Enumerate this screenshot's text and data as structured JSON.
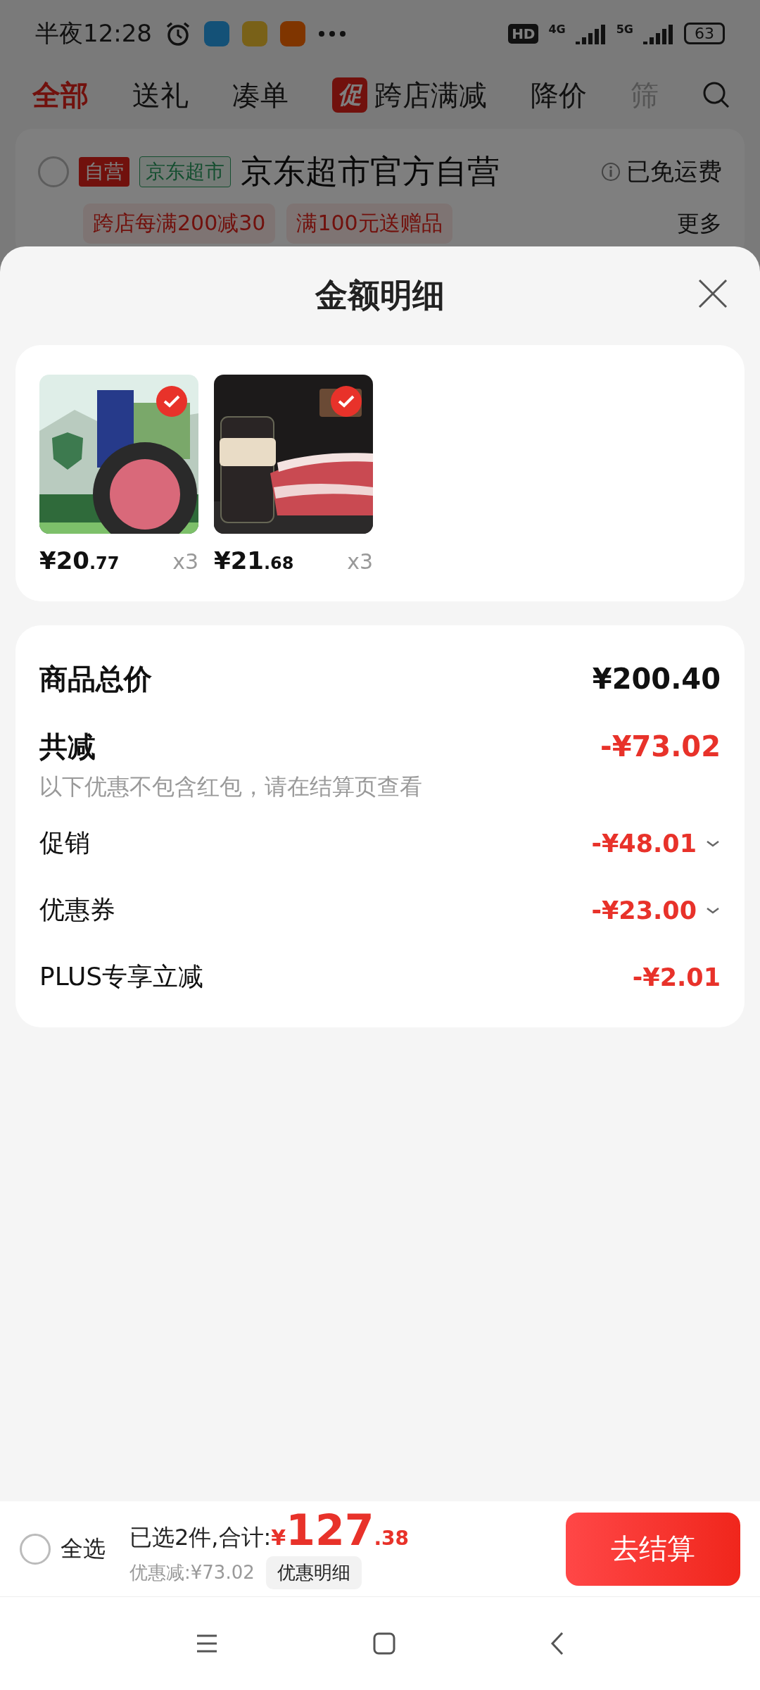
{
  "status_bar": {
    "time": "半夜12:28",
    "battery": "63",
    "network_labels": [
      "HD",
      "4G",
      "5G"
    ]
  },
  "tabs": [
    {
      "label": "全部",
      "selected": true
    },
    {
      "label": "送礼",
      "selected": false
    },
    {
      "label": "凑单",
      "selected": false
    },
    {
      "label": "跨店满减",
      "badge": "促",
      "selected": false
    },
    {
      "label": "降价",
      "selected": false
    },
    {
      "label": "筛",
      "selected": false
    }
  ],
  "store": {
    "checked": false,
    "tags": [
      {
        "label": "自营",
        "kind": "solid"
      },
      {
        "label": "京东超市",
        "kind": "outline"
      }
    ],
    "name": "京东超市官方自营",
    "shipping": "已免运费",
    "promos": [
      "跨店每满200减30",
      "满100元送赠品"
    ],
    "more": "更多"
  },
  "sheet": {
    "title": "金额明细",
    "products": [
      {
        "price_main": "¥20",
        "price_decimal": ".77",
        "quantity": "x3",
        "selected": true,
        "kind": "patty"
      },
      {
        "price_main": "¥21",
        "price_decimal": ".68",
        "quantity": "x3",
        "selected": true,
        "kind": "brisket"
      }
    ],
    "summary": [
      {
        "kind": "total",
        "label": "商品总价",
        "value": "¥200.40"
      },
      {
        "kind": "discount_total",
        "label": "共减",
        "value": "-¥73.02"
      },
      {
        "kind": "note",
        "label": "以下优惠不包含红包，请在结算页查看"
      },
      {
        "kind": "detail",
        "label": "促销",
        "value": "-¥48.01",
        "expandable": true
      },
      {
        "kind": "detail",
        "label": "优惠券",
        "value": "-¥23.00",
        "expandable": true
      },
      {
        "kind": "detail",
        "label": "PLUS专享立减",
        "value": "-¥2.01",
        "expandable": false
      }
    ]
  },
  "bottom_bar": {
    "select_all": {
      "label": "全选",
      "checked": false
    },
    "selected_text": "已选2件,合计:",
    "currency": "¥",
    "total_main": "127",
    "total_decimal": ".38",
    "discount_text": "优惠减:¥73.02",
    "detail_button": "优惠明细",
    "checkout_button": "去结算"
  }
}
